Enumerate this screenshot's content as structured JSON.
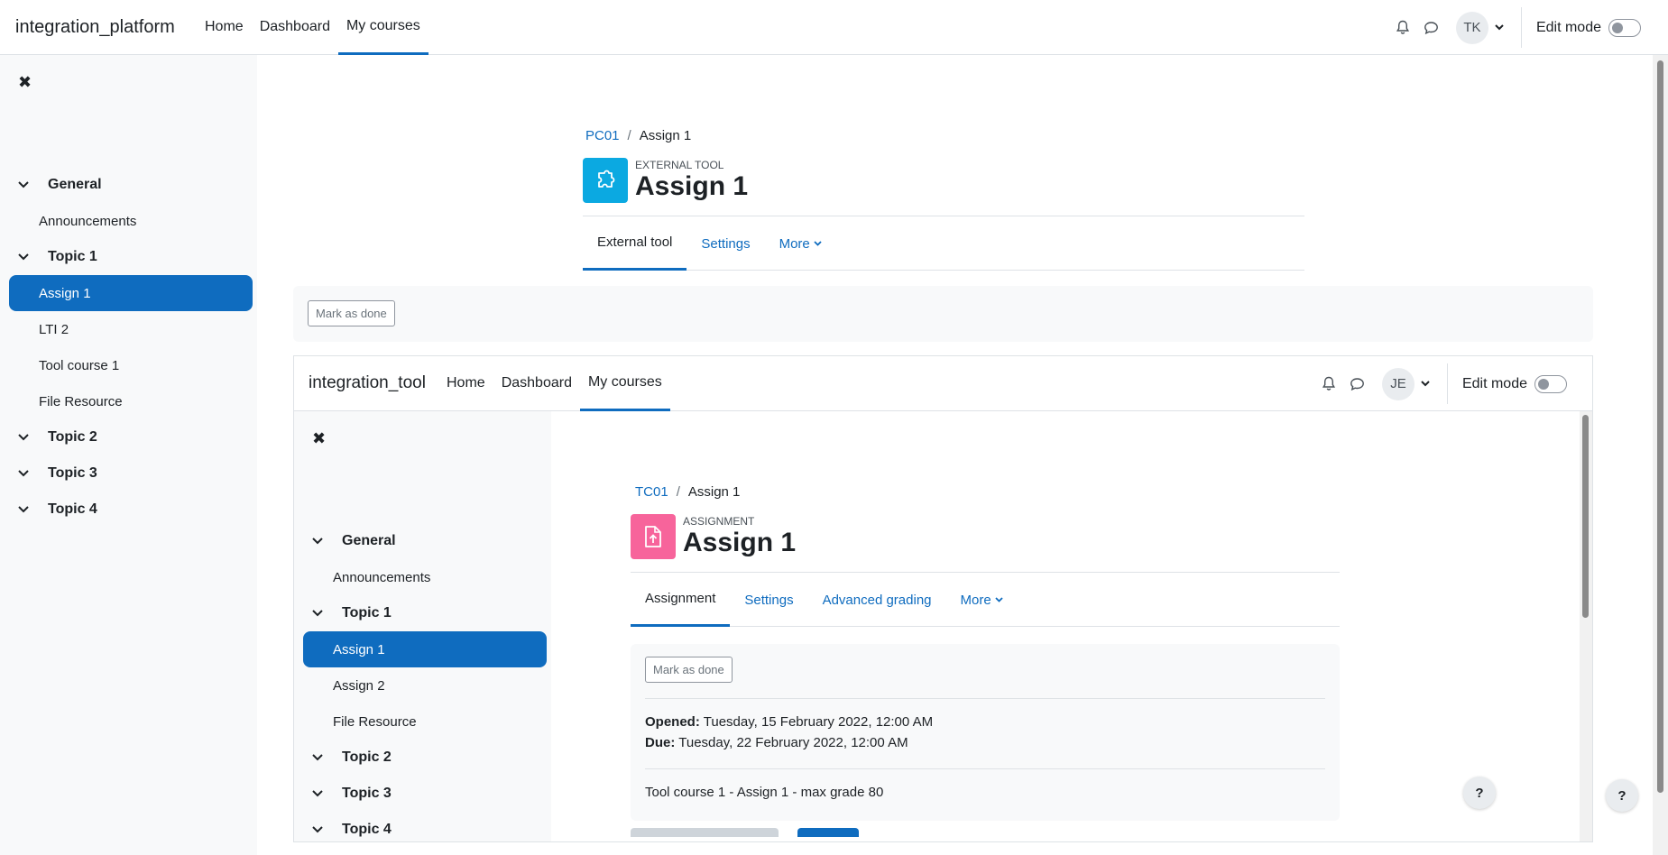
{
  "outer": {
    "brand": "integration_platform",
    "nav": [
      "Home",
      "Dashboard",
      "My courses"
    ],
    "avatar": "TK",
    "edit_mode": "Edit mode",
    "drawer": {
      "sections": [
        {
          "title": "General",
          "items": [
            "Announcements"
          ]
        },
        {
          "title": "Topic 1",
          "items": [
            "Assign 1",
            "LTI 2",
            "Tool course 1",
            "File Resource"
          ]
        },
        {
          "title": "Topic 2",
          "items": []
        },
        {
          "title": "Topic 3",
          "items": []
        },
        {
          "title": "Topic 4",
          "items": []
        }
      ],
      "active_item": "Assign 1"
    },
    "breadcrumb": {
      "course": "PC01",
      "current": "Assign 1"
    },
    "activity": {
      "type": "External tool",
      "title": "Assign 1",
      "icon": "puzzle-icon",
      "icon_color": "#0ba9e1"
    },
    "tabs": [
      "External tool",
      "Settings",
      "More"
    ],
    "mark_done": "Mark as done"
  },
  "inner": {
    "brand": "integration_tool",
    "nav": [
      "Home",
      "Dashboard",
      "My courses"
    ],
    "avatar": "JE",
    "edit_mode": "Edit mode",
    "drawer": {
      "sections": [
        {
          "title": "General",
          "items": [
            "Announcements"
          ]
        },
        {
          "title": "Topic 1",
          "items": [
            "Assign 1",
            "Assign 2",
            "File Resource"
          ]
        },
        {
          "title": "Topic 2",
          "items": []
        },
        {
          "title": "Topic 3",
          "items": []
        },
        {
          "title": "Topic 4",
          "items": []
        }
      ],
      "active_item": "Assign 1"
    },
    "breadcrumb": {
      "course": "TC01",
      "current": "Assign 1"
    },
    "activity": {
      "type": "Assignment",
      "title": "Assign 1",
      "icon": "file-upload-icon",
      "icon_color": "#f7649b"
    },
    "tabs": [
      "Assignment",
      "Settings",
      "Advanced grading",
      "More"
    ],
    "mark_done": "Mark as done",
    "dates": {
      "opened_label": "Opened:",
      "opened_value": "Tuesday, 15 February 2022, 12:00 AM",
      "due_label": "Due:",
      "due_value": "Tuesday, 22 February 2022, 12:00 AM"
    },
    "description": "Tool course 1 - Assign 1 - max grade 80"
  },
  "help": "?",
  "colors": {
    "primary": "#0f6cbf",
    "drawer_bg": "#f8f9fa"
  }
}
